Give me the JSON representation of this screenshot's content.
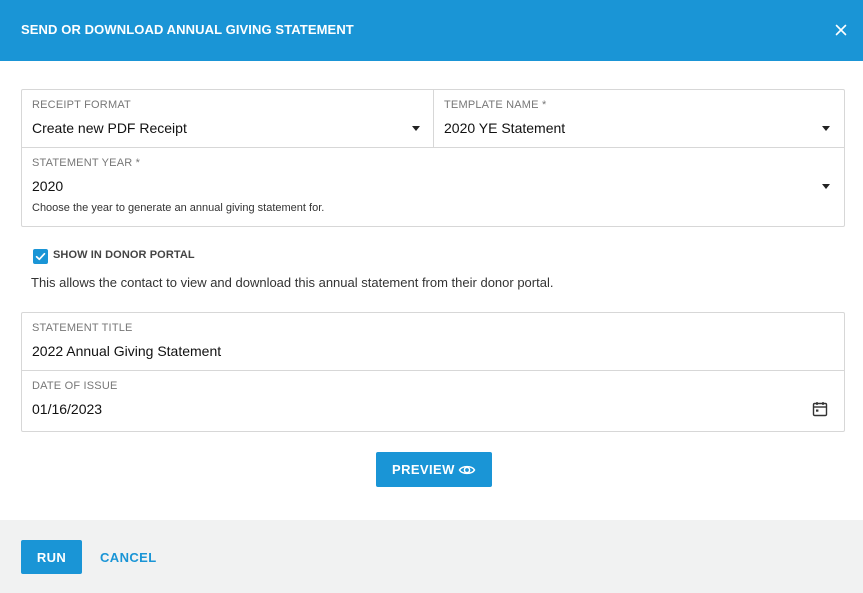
{
  "modal": {
    "title": "SEND OR DOWNLOAD ANNUAL GIVING STATEMENT",
    "accent_color": "#1a95d6"
  },
  "receipt_format": {
    "label": "RECEIPT FORMAT",
    "value": "Create new PDF Receipt"
  },
  "template_name": {
    "label": "TEMPLATE NAME *",
    "value": "2020 YE Statement"
  },
  "statement_year": {
    "label": "STATEMENT YEAR *",
    "value": "2020",
    "help": "Choose the year to generate an annual giving statement for."
  },
  "donor_portal": {
    "label": "SHOW IN DONOR PORTAL",
    "checked": true,
    "description": "This allows the contact to view and download this annual statement from their donor portal."
  },
  "statement_title": {
    "label": "STATEMENT TITLE",
    "value": "2022 Annual Giving Statement"
  },
  "date_of_issue": {
    "label": "DATE OF ISSUE",
    "value": "01/16/2023"
  },
  "preview": {
    "label": "PREVIEW",
    "icon": "eye-icon"
  },
  "footer": {
    "run_label": "RUN",
    "cancel_label": "CANCEL"
  }
}
